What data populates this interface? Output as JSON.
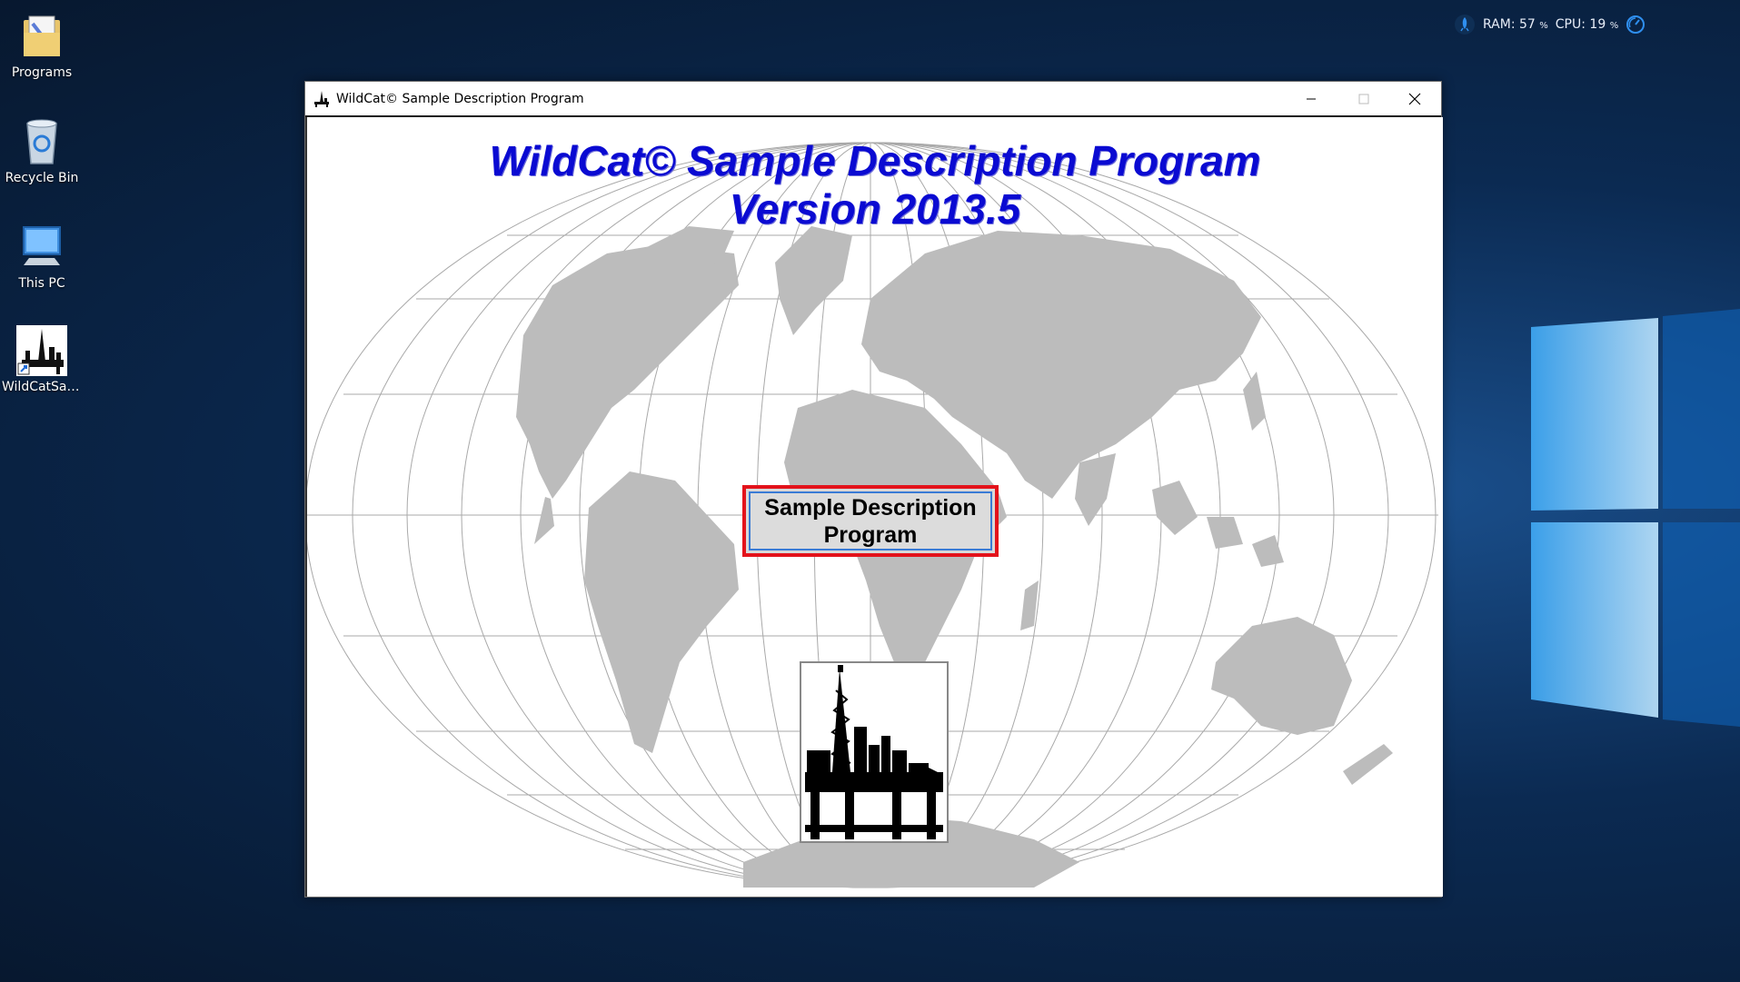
{
  "desktop": {
    "icons": [
      {
        "label": "Programs",
        "icon": "folder-icon"
      },
      {
        "label": "Recycle Bin",
        "icon": "recycle-bin-icon"
      },
      {
        "label": "This PC",
        "icon": "computer-icon"
      },
      {
        "label": "WildCatSam...",
        "icon": "wildcat-shortcut-icon"
      }
    ]
  },
  "sysmon": {
    "ram_label": "RAM: 57",
    "ram_unit": "%",
    "cpu_label": "CPU: 19",
    "cpu_unit": "%"
  },
  "window": {
    "title": "WildCat© Sample Description Program",
    "app_title_line1": "WildCat© Sample Description Program",
    "app_title_line2": "Version 2013.5",
    "launch_button_line1": "Sample Description",
    "launch_button_line2": "Program"
  },
  "colors": {
    "title_blue": "#0a0ad2",
    "highlight_red": "#e3121b",
    "continent_gray": "#bcbcbc"
  }
}
